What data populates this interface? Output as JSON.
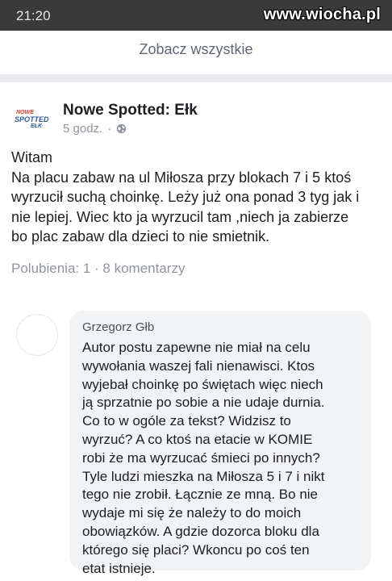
{
  "status_bar": {
    "time": "21:20"
  },
  "watermark": "www.wiocha.pl",
  "see_all": "Zobacz wszystkie",
  "post": {
    "page_logo_text": [
      "NOWE",
      "SPOTTED",
      "EŁK"
    ],
    "page_name": "Nowe Spotted: Ełk",
    "time": "5 godz.",
    "separator": "·",
    "lines": [
      "Witam",
      "Na placu zabaw na ul Miłosza przy blokach 7 i 5 ktoś",
      "wyrzucił suchą choinkę. Leży już ona ponad 3 tyg jak i",
      "nie lepiej. Wiec kto ja wyrzucil tam ,niech ja zabierze",
      "bo plac zabaw dla dzieci to nie smietnik."
    ],
    "stats": "Polubienia: 1 · 8 komentarzy"
  },
  "comment": {
    "author": "Grzegorz Głb",
    "lines": [
      "Autor postu zapewne nie miał na celu",
      "wywołania waszej fali nienawisci. Ktos",
      "wyjebał choinkę po świętach więc niech",
      "ją sprzatnie po sobie a nie udaje durnia.",
      "Co to w ogóle za tekst? Widzisz to",
      "wyrzuć? A co ktoś na etacie w KOMIE",
      "robi że ma wyrzucać śmieci po innych?",
      "Tyle ludzi mieszka na Miłosza 5 i 7 i nikt",
      "tego nie zrobił. Łącznie ze mną. Bo nie",
      "wydaje mi się że należy to do moich",
      "obowiązków. A gdzie dozorca bloku dla",
      "którego się placi? Wkoncu po coś ten",
      "etat istnieje."
    ]
  },
  "icons": {
    "privacy": "globe-icon"
  },
  "colors": {
    "status_bar": "#3a3a3a",
    "bubble": "#f2f3f5",
    "meta_text": "#90949c",
    "logo_red": "#d73a2f",
    "logo_blue": "#2c5aa0"
  }
}
